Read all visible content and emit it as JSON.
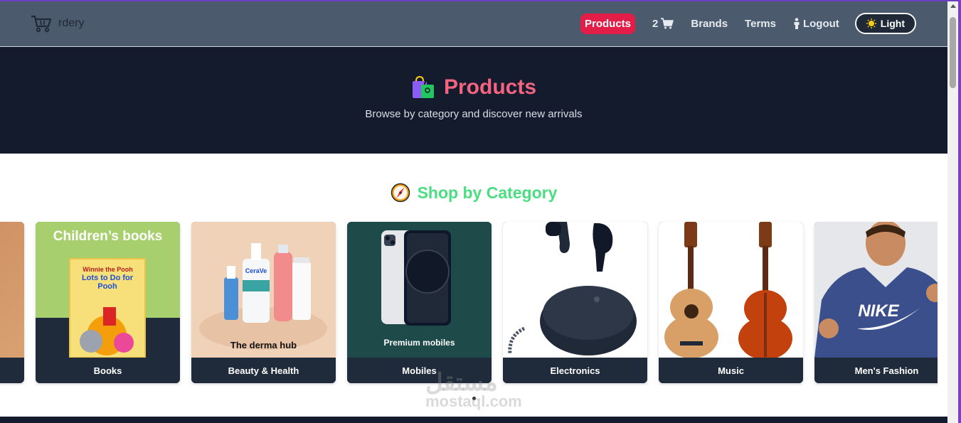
{
  "navbar": {
    "brand": "rdery",
    "links": {
      "products": "Products",
      "cart_count": "2",
      "brands": "Brands",
      "terms": "Terms",
      "logout": "Logout"
    },
    "theme_toggle": "Light"
  },
  "hero": {
    "title": "Products",
    "subtitle": "Browse by category and discover new arrivals"
  },
  "categories": {
    "title": "Shop by Category",
    "items": [
      {
        "label": "Books",
        "image_caption": "Children’s books"
      },
      {
        "label": "Beauty & Health",
        "image_caption": "The derma hub"
      },
      {
        "label": "Mobiles",
        "image_caption": "Premium mobiles"
      },
      {
        "label": "Electronics",
        "image_caption": ""
      },
      {
        "label": "Music",
        "image_caption": ""
      },
      {
        "label": "Men's Fashion",
        "image_caption": ""
      }
    ],
    "book_cover": "Lots to Do for Pooh",
    "book_brand": "Winnie the Pooh",
    "serum_brand": "CeraVe",
    "hoodie_brand": "NIKE"
  },
  "watermark": {
    "arabic": "مستقل",
    "latin": "mostaql.com"
  },
  "colors": {
    "accent_red": "#e11d48",
    "hero_bg": "#141b2d",
    "title_pink": "#f4637f",
    "section_green": "#4ade80"
  }
}
